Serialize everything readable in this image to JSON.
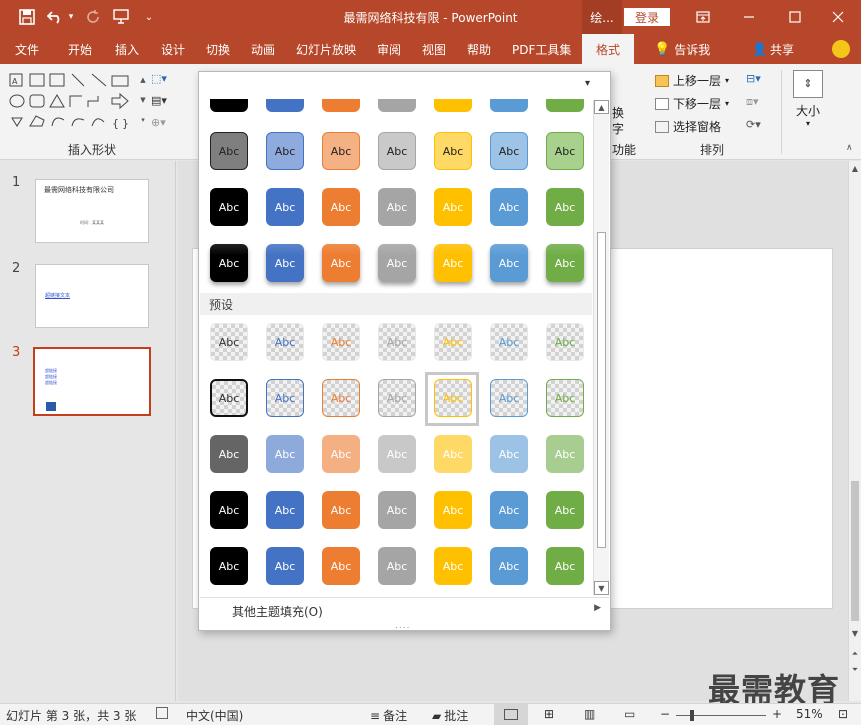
{
  "titlebar": {
    "title": "最需网络科技有限  -  PowerPoint",
    "quick_access": [
      {
        "name": "save-icon",
        "glyph": "💾"
      },
      {
        "name": "undo-icon",
        "glyph": "↶"
      },
      {
        "name": "redo-icon",
        "glyph": "↻"
      },
      {
        "name": "present-icon",
        "glyph": "⎚"
      },
      {
        "name": "customize-icon",
        "glyph": "⌄"
      }
    ],
    "context_tab": "绘...",
    "login": "登录",
    "window_buttons": [
      {
        "name": "ribbon-display-icon",
        "glyph": "⧉"
      },
      {
        "name": "minimize-icon",
        "glyph": "—"
      },
      {
        "name": "maximize-icon",
        "glyph": "☐"
      },
      {
        "name": "close-icon",
        "glyph": "✕"
      }
    ]
  },
  "ribbon_tabs": [
    "文件",
    "开始",
    "插入",
    "设计",
    "切换",
    "动画",
    "幻灯片放映",
    "审阅",
    "视图",
    "帮助",
    "PDF工具集",
    "格式",
    "告诉我",
    "共享"
  ],
  "ribbon": {
    "insert_shapes_label": "插入形状",
    "arrange_label": "排列",
    "partial_left": "换",
    "partial_left2": "字",
    "partial_func": "功能",
    "bring_forward": "上移一层",
    "send_backward": "下移一层",
    "selection_pane": "选择窗格",
    "size": "大小"
  },
  "thumbnails": [
    {
      "num": "1",
      "title": "最需网络科技有限公司",
      "sub": "时间：某某某"
    },
    {
      "num": "2",
      "link": "超链接文本"
    },
    {
      "num": "3",
      "lines": [
        "超链接",
        "超链接",
        "超链接"
      ]
    }
  ],
  "gallery": {
    "section_label": "预设",
    "swatch_text": "Abc",
    "more_fill": "其他主题填充(O)",
    "grip": "....",
    "colors": [
      "#000000",
      "#4472c4",
      "#ed7d31",
      "#a5a5a5",
      "#ffc000",
      "#5b9bd5",
      "#70ad47"
    ],
    "light_colors": [
      "#7f7f7f",
      "#8faadc",
      "#f4b183",
      "#c9c9c9",
      "#ffd966",
      "#9dc3e6",
      "#a9d18e"
    ],
    "light_borders": [
      "#404040",
      "#4472c4",
      "#ed7d31",
      "#a5a5a5",
      "#ffc000",
      "#5b9bd5",
      "#70ad47"
    ]
  },
  "status": {
    "slide_info": "幻灯片 第 3 张，共 3 张",
    "language": "中文(中国)",
    "notes": "备注",
    "comments": "批注",
    "zoom": "51%",
    "zoom_minus": "−",
    "zoom_plus": "+"
  },
  "watermark": "最需教育"
}
